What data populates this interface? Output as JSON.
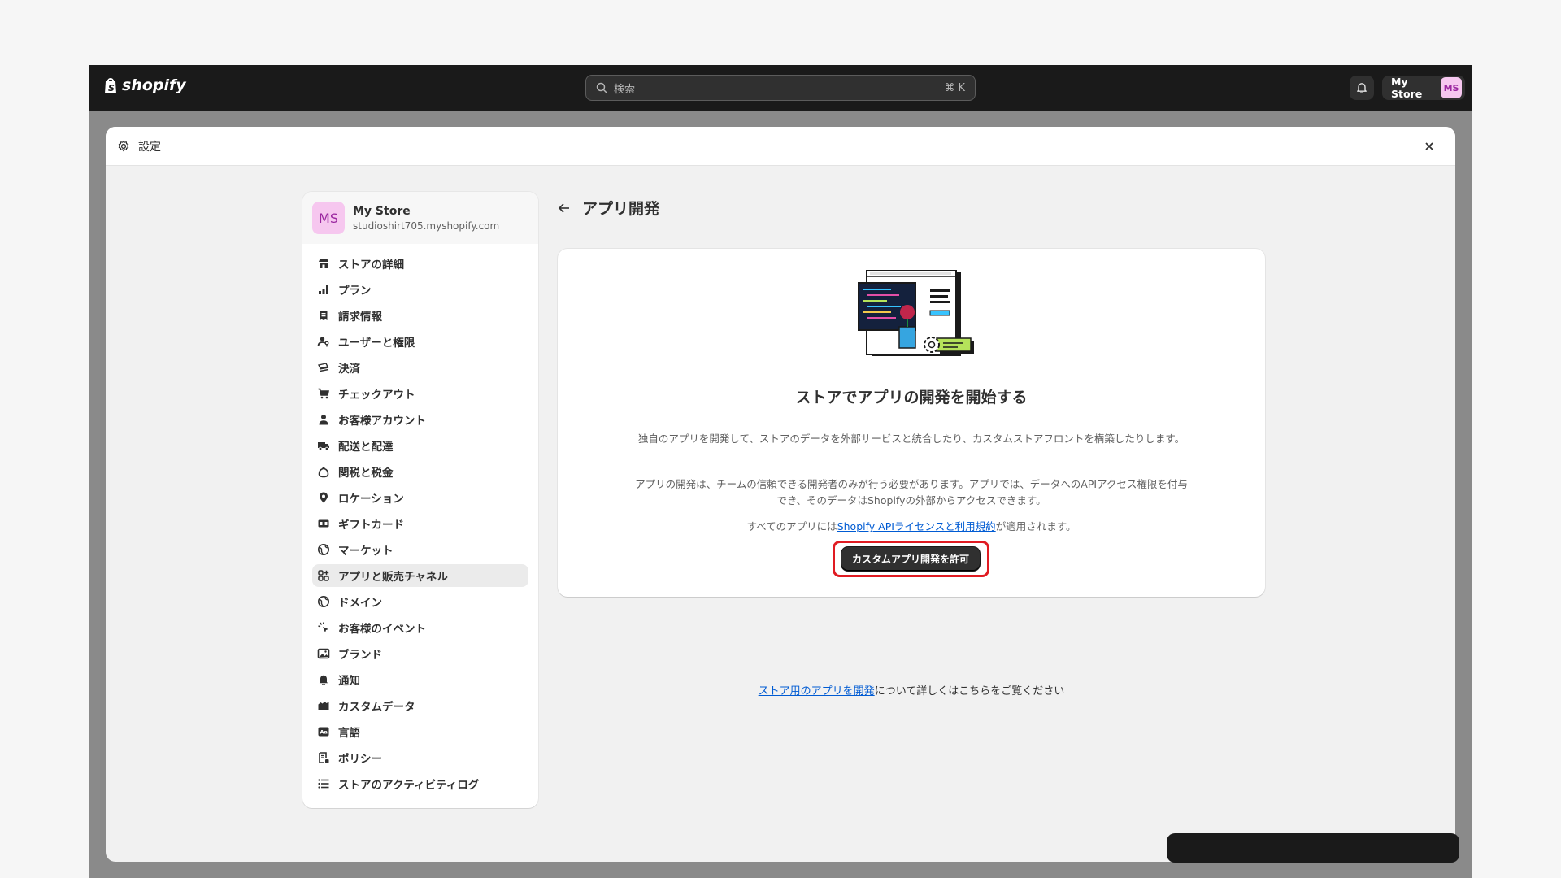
{
  "topbar": {
    "logo_text": "shopify",
    "search_placeholder": "検索",
    "search_shortcut": "⌘ K",
    "store_name": "My Store",
    "store_initials": "MS"
  },
  "modal": {
    "title": "設定"
  },
  "sidebar": {
    "store_initials": "MS",
    "store_name": "My Store",
    "store_url": "studioshirt705.myshopify.com",
    "items": [
      {
        "label": "ストアの詳細",
        "icon": "store-icon"
      },
      {
        "label": "プラン",
        "icon": "plan-chart-icon"
      },
      {
        "label": "請求情報",
        "icon": "receipt-icon"
      },
      {
        "label": "ユーザーと権限",
        "icon": "user-key-icon"
      },
      {
        "label": "決済",
        "icon": "payment-icon"
      },
      {
        "label": "チェックアウト",
        "icon": "cart-icon"
      },
      {
        "label": "お客様アカウント",
        "icon": "person-icon"
      },
      {
        "label": "配送と配達",
        "icon": "truck-icon"
      },
      {
        "label": "関税と税金",
        "icon": "money-bag-icon"
      },
      {
        "label": "ロケーション",
        "icon": "location-pin-icon"
      },
      {
        "label": "ギフトカード",
        "icon": "gift-card-icon"
      },
      {
        "label": "マーケット",
        "icon": "globe-icon"
      },
      {
        "label": "アプリと販売チャネル",
        "icon": "apps-icon"
      },
      {
        "label": "ドメイン",
        "icon": "globe-icon"
      },
      {
        "label": "お客様のイベント",
        "icon": "sparkle-icon"
      },
      {
        "label": "ブランド",
        "icon": "brand-image-icon"
      },
      {
        "label": "通知",
        "icon": "bell-icon"
      },
      {
        "label": "カスタムデータ",
        "icon": "database-icon"
      },
      {
        "label": "言語",
        "icon": "language-icon"
      },
      {
        "label": "ポリシー",
        "icon": "policy-icon"
      },
      {
        "label": "ストアのアクティビティログ",
        "icon": "list-icon"
      }
    ],
    "active_index": 12
  },
  "main": {
    "page_title": "アプリ開発",
    "card": {
      "heading": "ストアでアプリの開発を開始する",
      "paragraph1": "独自のアプリを開発して、ストアのデータを外部サービスと統合したり、カスタムストアフロントを構築したりします。",
      "paragraph2": "アプリの開発は、チームの信頼できる開発者のみが行う必要があります。アプリでは、データへのAPIアクセス権限を付与でき、そのデータはShopifyの外部からアクセスできます。",
      "paragraph3_prefix": "すべてのアプリには",
      "paragraph3_link": "Shopify APIライセンスと利用規約",
      "paragraph3_suffix": "が適用されます。",
      "button_label": "カスタムアプリ開発を許可"
    },
    "footer_link": "ストア用のアプリを開発",
    "footer_suffix": "について詳しくはこちらをご覧ください"
  },
  "colors": {
    "topbar": "#1a1a1a",
    "avatar_bg": "#f6c7ef",
    "link": "#005bd3",
    "highlight": "#e01b22",
    "primary_button": "#303030"
  }
}
